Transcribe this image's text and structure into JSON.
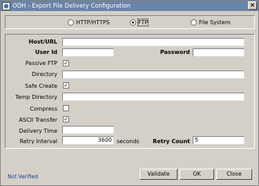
{
  "window": {
    "title": "ODH - Export File Delivery Configuration"
  },
  "protocol": {
    "options": [
      "HTTP/HTTPS",
      "FTP",
      "File System"
    ],
    "selected": "FTP"
  },
  "form": {
    "host_url_label": "Host/URL",
    "host_url_value": "",
    "user_id_label": "User Id",
    "user_id_value": "",
    "password_label": "Password",
    "password_value": "",
    "passive_ftp_label": "Passive FTP",
    "passive_ftp_checked": true,
    "directory_label": "Directory",
    "directory_value": "",
    "safe_create_label": "Safe Create",
    "safe_create_checked": true,
    "temp_directory_label": "Temp Directory",
    "temp_directory_value": "",
    "compress_label": "Compress",
    "compress_checked": false,
    "ascii_transfer_label": "ASCII Transfer",
    "ascii_transfer_checked": true,
    "delivery_time_label": "Delivery Time",
    "delivery_time_value": "",
    "retry_interval_label": "Retry Interval",
    "retry_interval_value": "3600",
    "retry_interval_unit": "seconds",
    "retry_count_label": "Retry Count",
    "retry_count_value": "5"
  },
  "status": {
    "text": "Not Verified"
  },
  "buttons": {
    "validate": "Validate",
    "ok": "OK",
    "close": "Close"
  },
  "check_mark": "✓"
}
